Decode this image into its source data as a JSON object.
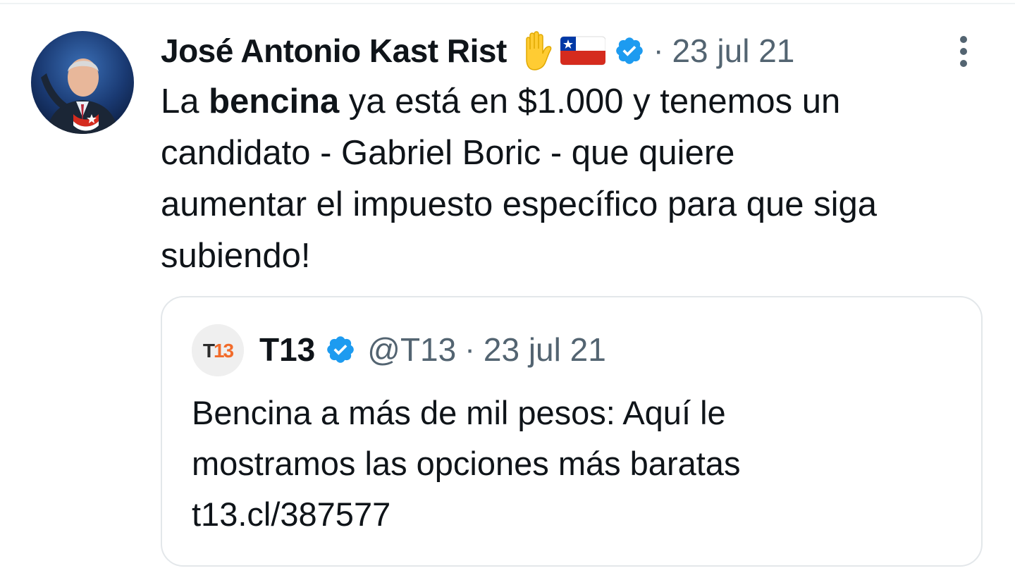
{
  "tweet": {
    "author_name": "José Antonio Kast Rist",
    "emojis": [
      "raised-hand-emoji",
      "chile-flag-emoji"
    ],
    "verified": true,
    "separator": "·",
    "date": "23 jul 21",
    "text_pre": "La ",
    "text_bold": "bencina",
    "text_line1_rest": " ya está en $1.000 y tenemos un",
    "text_line2": "candidato - Gabriel Boric - que quiere",
    "text_line3": "aumentar el impuesto específico para que siga",
    "text_line4": "subiendo!"
  },
  "quoted": {
    "avatar_logo": "T13",
    "name": "T13",
    "verified": true,
    "handle": "@T13",
    "separator": "·",
    "date": "23 jul 21",
    "text_line1": "Bencina a más de mil pesos: Aquí le",
    "text_line2": "mostramos las opciones más baratas",
    "link": "t13.cl/387577"
  },
  "colors": {
    "text": "#0f1419",
    "secondary": "#536471",
    "verified_blue": "#1d9bf0",
    "border": "#e3e7ea",
    "t13_orange": "#f26b2a"
  }
}
